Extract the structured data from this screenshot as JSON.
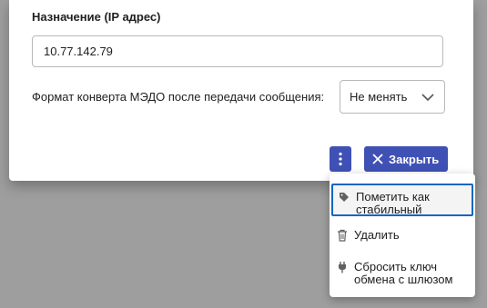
{
  "dialog": {
    "destination_label": "Назначение (IP адрес)",
    "destination_value": "10.77.142.79",
    "format_label": "Формат конверта МЭДО после передачи сообщения:",
    "format_selected": "Не менять",
    "close_label": "Закрыть"
  },
  "menu": {
    "items": [
      {
        "label": "Пометить как стабильный",
        "icon": "tag-icon"
      },
      {
        "label": "Удалить",
        "icon": "trash-icon"
      },
      {
        "label": "Сбросить ключ обмена с шлюзом",
        "icon": "plug-icon"
      }
    ]
  },
  "colors": {
    "primary": "#3f51b5",
    "focus_outline": "#1565c0",
    "backdrop": "#9e9e9e"
  }
}
